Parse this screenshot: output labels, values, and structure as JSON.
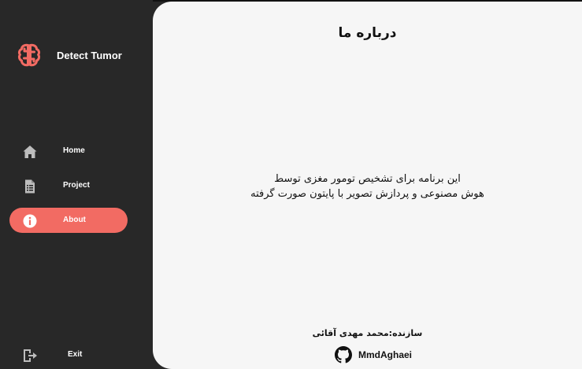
{
  "app": {
    "brand_name": "Detect Tumor"
  },
  "sidebar": {
    "items": [
      {
        "label": "Home",
        "icon": "home-icon"
      },
      {
        "label": "Project",
        "icon": "document-icon"
      },
      {
        "label": "About",
        "icon": "info-icon",
        "active": true
      }
    ],
    "exit": {
      "label": "Exit",
      "icon": "exit-icon"
    }
  },
  "main": {
    "title": "درباره ما",
    "description_line1": "این برنامه برای تشخیص تومور مغزی توسط",
    "description_line2": "هوش مصنوعی و پردازش تصویر با پایتون صورت گرفته",
    "author": "سازنده:محمد مهدی آقائی",
    "github": {
      "username": "MmdAghaei",
      "icon": "github-icon"
    }
  },
  "colors": {
    "sidebar_bg": "#282828",
    "main_bg": "#f6f6f6",
    "accent": "#f26b63",
    "text_light": "#ffffff",
    "text_dark": "#111111"
  }
}
